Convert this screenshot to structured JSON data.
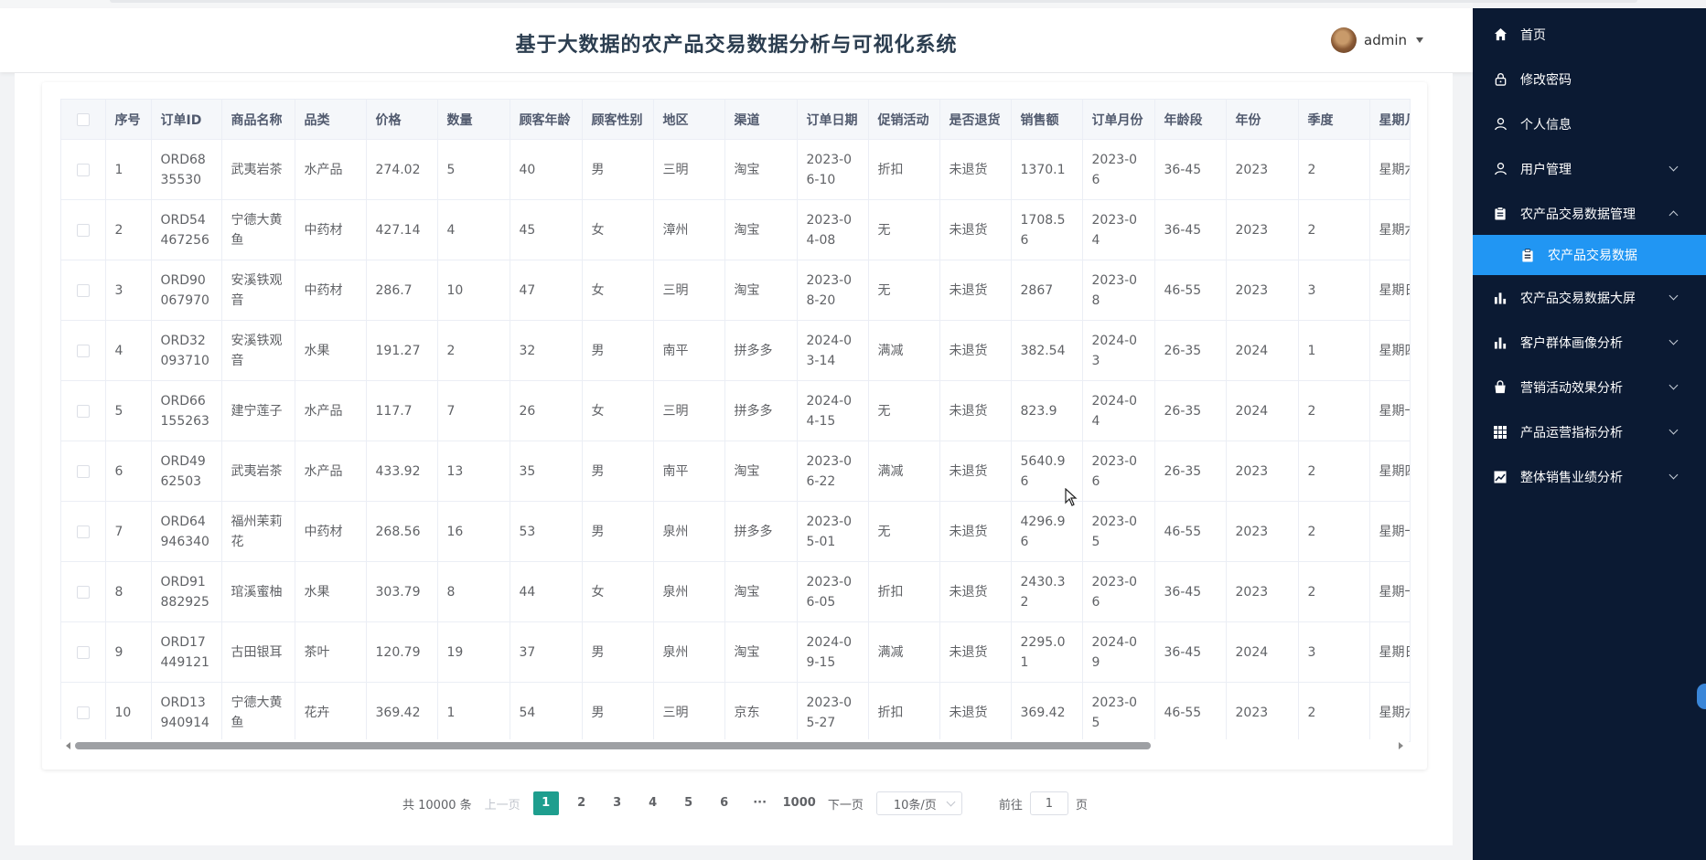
{
  "header": {
    "title": "基于大数据的农产品交易数据分析与可视化系统",
    "username": "admin"
  },
  "table": {
    "columns": [
      "序号",
      "订单ID",
      "商品名称",
      "品类",
      "价格",
      "数量",
      "顾客年龄",
      "顾客性别",
      "地区",
      "渠道",
      "订单日期",
      "促销活动",
      "是否退货",
      "销售额",
      "订单月份",
      "年龄段",
      "年份",
      "季度",
      "星期几"
    ],
    "rows": [
      [
        "1",
        "ORD6835530",
        "武夷岩茶",
        "水产品",
        "274.02",
        "5",
        "40",
        "男",
        "三明",
        "淘宝",
        "2023-06-10",
        "折扣",
        "未退货",
        "1370.1",
        "2023-06",
        "36-45",
        "2023",
        "2",
        "星期六"
      ],
      [
        "2",
        "ORD54467256",
        "宁德大黄鱼",
        "中药材",
        "427.14",
        "4",
        "45",
        "女",
        "漳州",
        "淘宝",
        "2023-04-08",
        "无",
        "未退货",
        "1708.56",
        "2023-04",
        "36-45",
        "2023",
        "2",
        "星期六"
      ],
      [
        "3",
        "ORD90067970",
        "安溪铁观音",
        "中药材",
        "286.7",
        "10",
        "47",
        "女",
        "三明",
        "淘宝",
        "2023-08-20",
        "无",
        "未退货",
        "2867",
        "2023-08",
        "46-55",
        "2023",
        "3",
        "星期日"
      ],
      [
        "4",
        "ORD32093710",
        "安溪铁观音",
        "水果",
        "191.27",
        "2",
        "32",
        "男",
        "南平",
        "拼多多",
        "2024-03-14",
        "满减",
        "未退货",
        "382.54",
        "2024-03",
        "26-35",
        "2024",
        "1",
        "星期四"
      ],
      [
        "5",
        "ORD66155263",
        "建宁莲子",
        "水产品",
        "117.7",
        "7",
        "26",
        "女",
        "三明",
        "拼多多",
        "2024-04-15",
        "无",
        "未退货",
        "823.9",
        "2024-04",
        "26-35",
        "2024",
        "2",
        "星期一"
      ],
      [
        "6",
        "ORD4962503",
        "武夷岩茶",
        "水产品",
        "433.92",
        "13",
        "35",
        "男",
        "南平",
        "淘宝",
        "2023-06-22",
        "满减",
        "未退货",
        "5640.96",
        "2023-06",
        "26-35",
        "2023",
        "2",
        "星期四"
      ],
      [
        "7",
        "ORD64946340",
        "福州茉莉花",
        "中药材",
        "268.56",
        "16",
        "53",
        "男",
        "泉州",
        "拼多多",
        "2023-05-01",
        "无",
        "未退货",
        "4296.96",
        "2023-05",
        "46-55",
        "2023",
        "2",
        "星期一"
      ],
      [
        "8",
        "ORD91882925",
        "琯溪蜜柚",
        "水果",
        "303.79",
        "8",
        "44",
        "女",
        "泉州",
        "淘宝",
        "2023-06-05",
        "折扣",
        "未退货",
        "2430.32",
        "2023-06",
        "36-45",
        "2023",
        "2",
        "星期一"
      ],
      [
        "9",
        "ORD17449121",
        "古田银耳",
        "茶叶",
        "120.79",
        "19",
        "37",
        "男",
        "泉州",
        "淘宝",
        "2024-09-15",
        "满减",
        "未退货",
        "2295.01",
        "2024-09",
        "36-45",
        "2024",
        "3",
        "星期日"
      ],
      [
        "10",
        "ORD13940914",
        "宁德大黄鱼",
        "花卉",
        "369.42",
        "1",
        "54",
        "男",
        "三明",
        "京东",
        "2023-05-27",
        "折扣",
        "未退货",
        "369.42",
        "2023-05",
        "46-55",
        "2023",
        "2",
        "星期六"
      ]
    ]
  },
  "pagination": {
    "total": "共 10000 条",
    "prev": "上一页",
    "pages": [
      "1",
      "2",
      "3",
      "4",
      "5",
      "6",
      "···",
      "1000"
    ],
    "current": "1",
    "next": "下一页",
    "page_size": "10条/页",
    "goto_label": "前往",
    "goto_value": "1",
    "goto_suffix": "页"
  },
  "sidebar": {
    "items": [
      {
        "label": "首页",
        "icon": "home-icon",
        "arrow": ""
      },
      {
        "label": "修改密码",
        "icon": "lock-icon",
        "arrow": ""
      },
      {
        "label": "个人信息",
        "icon": "user-icon",
        "arrow": ""
      },
      {
        "label": "用户管理",
        "icon": "user-icon",
        "arrow": "down"
      },
      {
        "label": "农产品交易数据管理",
        "icon": "clipboard-icon",
        "arrow": "up"
      },
      {
        "label": "农产品交易数据",
        "icon": "clipboard-icon",
        "arrow": "",
        "active": true
      },
      {
        "label": "农产品交易数据大屏",
        "icon": "bar-chart-icon",
        "arrow": "down"
      },
      {
        "label": "客户群体画像分析",
        "icon": "bar-chart-icon",
        "arrow": "down"
      },
      {
        "label": "营销活动效果分析",
        "icon": "bag-icon",
        "arrow": "down"
      },
      {
        "label": "产品运营指标分析",
        "icon": "grid-icon",
        "arrow": "down"
      },
      {
        "label": "整体销售业绩分析",
        "icon": "trend-icon",
        "arrow": "down"
      }
    ]
  },
  "colors": {
    "accent": "#1e9e8e",
    "sidebar_bg": "#0b1a33",
    "sidebar_active": "#2196f3"
  }
}
